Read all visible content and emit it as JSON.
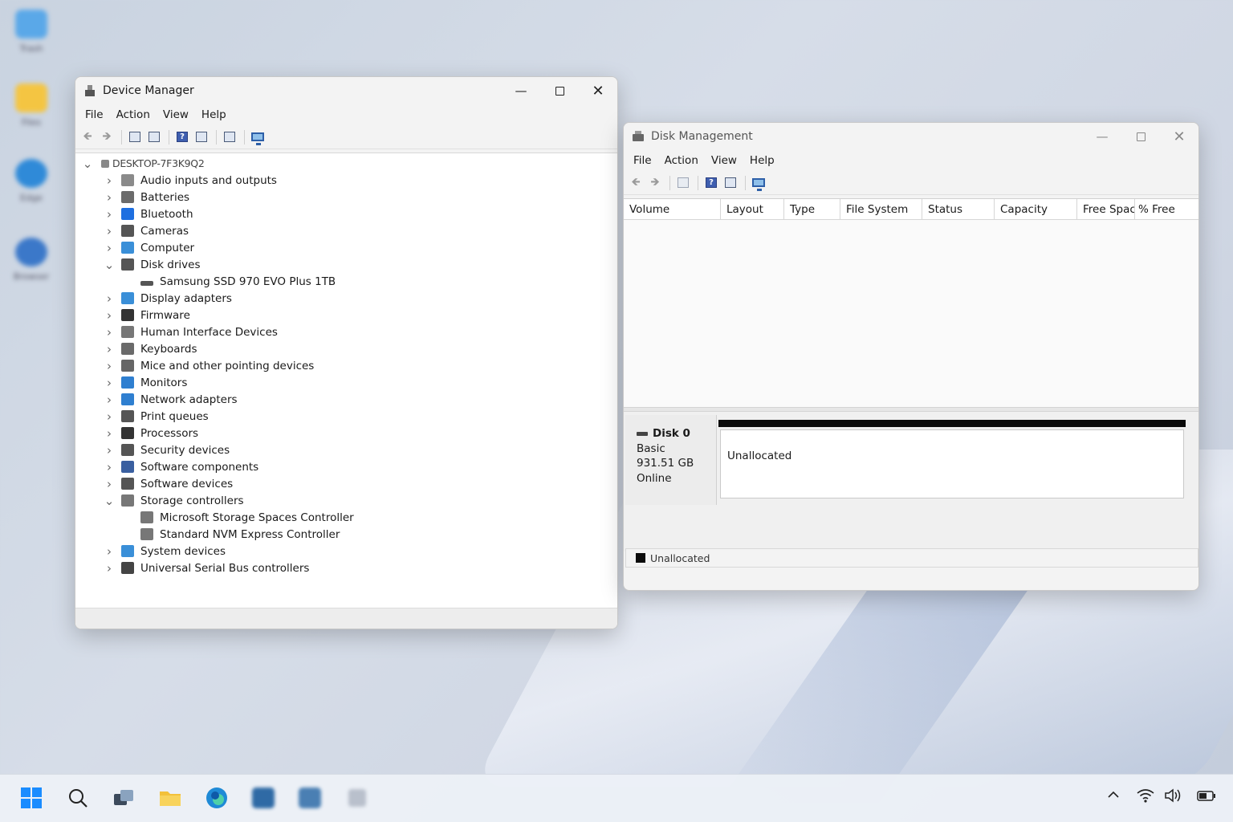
{
  "device_manager": {
    "title": "Device Manager",
    "menu": [
      "File",
      "Action",
      "View",
      "Help"
    ],
    "root": "DESKTOP-7F3K9Q2",
    "tree": [
      {
        "label": "Audio inputs and outputs",
        "expanded": false,
        "icon": "speaker-icon",
        "color": "#8a8a8a"
      },
      {
        "label": "Batteries",
        "expanded": false,
        "icon": "battery-icon",
        "color": "#6b6b6b"
      },
      {
        "label": "Bluetooth",
        "expanded": false,
        "icon": "bluetooth-icon",
        "color": "#1e6fe0"
      },
      {
        "label": "Cameras",
        "expanded": false,
        "icon": "camera-icon",
        "color": "#555555"
      },
      {
        "label": "Computer",
        "expanded": false,
        "icon": "computer-icon",
        "color": "#3a8fd8"
      },
      {
        "label": "Disk drives",
        "expanded": true,
        "icon": "disk-drive-icon",
        "color": "#555555",
        "children": [
          {
            "label": "Samsung SSD 970 EVO Plus 1TB",
            "icon": "disk-drive-icon"
          }
        ]
      },
      {
        "label": "Display adapters",
        "expanded": false,
        "icon": "display-adapter-icon",
        "color": "#3a8fd8"
      },
      {
        "label": "Firmware",
        "expanded": false,
        "icon": "firmware-icon",
        "color": "#333333"
      },
      {
        "label": "Human Interface Devices",
        "expanded": false,
        "icon": "hid-icon",
        "color": "#777777"
      },
      {
        "label": "Keyboards",
        "expanded": false,
        "icon": "keyboard-icon",
        "color": "#6a6a6a"
      },
      {
        "label": "Mice and other pointing devices",
        "expanded": false,
        "icon": "mouse-icon",
        "color": "#666666"
      },
      {
        "label": "Monitors",
        "expanded": false,
        "icon": "monitor-icon",
        "color": "#2f7fd0"
      },
      {
        "label": "Network adapters",
        "expanded": false,
        "icon": "network-adapter-icon",
        "color": "#2f7fd0"
      },
      {
        "label": "Print queues",
        "expanded": false,
        "icon": "printer-icon",
        "color": "#555555"
      },
      {
        "label": "Processors",
        "expanded": false,
        "icon": "processor-icon",
        "color": "#333333"
      },
      {
        "label": "Security devices",
        "expanded": false,
        "icon": "security-device-icon",
        "color": "#555555"
      },
      {
        "label": "Software components",
        "expanded": false,
        "icon": "software-component-icon",
        "color": "#3a5fa0"
      },
      {
        "label": "Software devices",
        "expanded": false,
        "icon": "software-device-icon",
        "color": "#555555"
      },
      {
        "label": "Storage controllers",
        "expanded": true,
        "icon": "storage-controller-icon",
        "color": "#777777",
        "children": [
          {
            "label": "Microsoft Storage Spaces Controller",
            "icon": "storage-controller-icon"
          },
          {
            "label": "Standard NVM Express Controller",
            "icon": "storage-controller-icon"
          }
        ]
      },
      {
        "label": "System devices",
        "expanded": false,
        "icon": "system-device-icon",
        "color": "#3a8fd8"
      },
      {
        "label": "Universal Serial Bus controllers",
        "expanded": false,
        "icon": "usb-icon",
        "color": "#444444"
      }
    ]
  },
  "disk_management": {
    "title": "Disk Management",
    "menu": [
      "File",
      "Action",
      "View",
      "Help"
    ],
    "columns": [
      "Volume",
      "Layout",
      "Type",
      "File System",
      "Status",
      "Capacity",
      "Free Space",
      "% Free"
    ],
    "disk": {
      "name": "Disk 0",
      "type": "Basic",
      "size": "931.51 GB",
      "status": "Online",
      "partition_label": "Unallocated"
    },
    "legend": "Unallocated"
  },
  "desktop_icons": [
    {
      "icon": "recycle-bin-icon",
      "label": "Trash"
    },
    {
      "icon": "folder-icon",
      "label": "Files"
    },
    {
      "icon": "edge-icon",
      "label": "Edge"
    },
    {
      "icon": "browser-icon",
      "label": "Browser"
    }
  ],
  "colors": {
    "accent": "#0067c0",
    "unallocated": "#0b0b0b"
  }
}
